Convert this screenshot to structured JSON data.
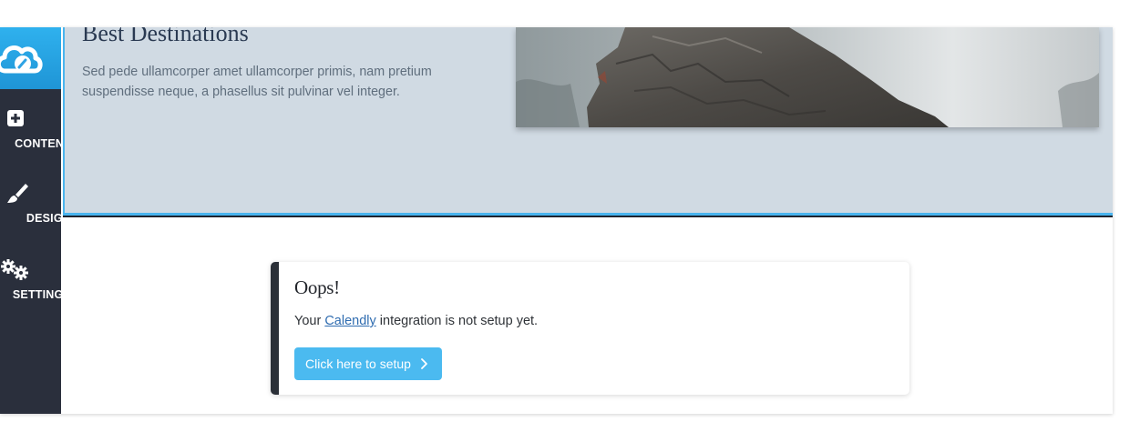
{
  "sidebar": {
    "logo_icon": "cloud-edit-icon",
    "items": [
      {
        "label": "CONTENT",
        "icon": "plus-square-icon"
      },
      {
        "label": "DESIGN",
        "icon": "paintbrush-icon"
      },
      {
        "label": "SETTINGS",
        "icon": "gears-icon"
      }
    ]
  },
  "hero": {
    "title": "Best Destinations",
    "text": "Sed pede ullamcorper amet ullamcorper primis, nam pretium suspendisse neque, a phasellus sit pulvinar vel integer.",
    "image_subject": "rocky-cliff-in-fog"
  },
  "notice": {
    "title": "Oops!",
    "message_prefix": "Your ",
    "link_text": "Calendly",
    "message_suffix": " integration is not setup yet.",
    "button_label": "Click here to setup",
    "button_icon": "chevron-right-icon"
  },
  "colors": {
    "accent": "#4bbaf0",
    "sidebar_bg": "#2a2f3c",
    "hero_bg": "#d0dae3",
    "link": "#2f6cb0"
  }
}
